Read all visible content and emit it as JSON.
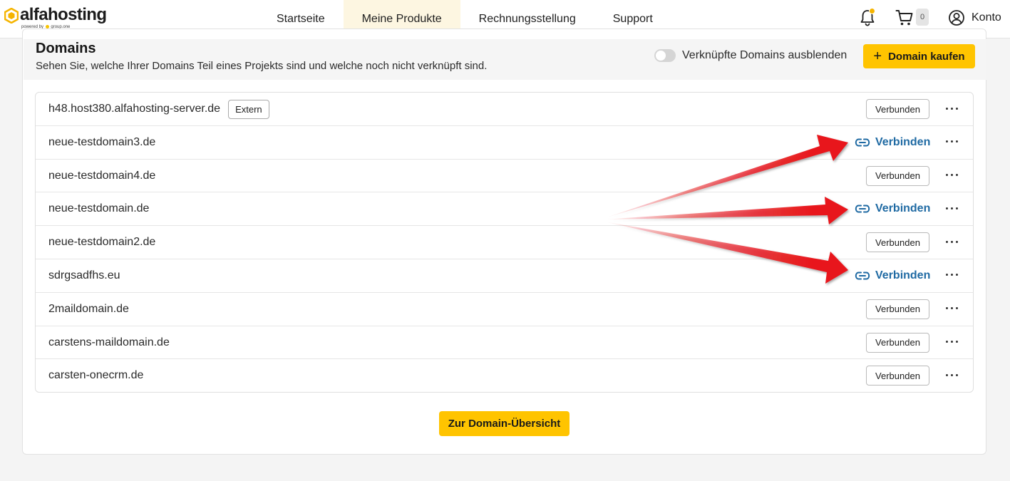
{
  "brand": {
    "name": "alfahosting",
    "tagline_prefix": "powered by",
    "tagline_suffix": "group.one"
  },
  "nav": {
    "items": [
      {
        "label": "Startseite",
        "active": false
      },
      {
        "label": "Meine Produkte",
        "active": true
      },
      {
        "label": "Rechnungsstellung",
        "active": false
      },
      {
        "label": "Support",
        "active": false
      }
    ]
  },
  "header_icons": {
    "notifications_icon": "bell-icon",
    "cart_icon": "cart-icon",
    "cart_count": "0",
    "account_label": "Konto"
  },
  "domains_section": {
    "title": "Domains",
    "subtitle": "Sehen Sie, welche Ihrer Domains Teil eines Projekts sind und welche noch nicht verknüpft sind.",
    "toggle_label": "Verknüpfte Domains ausblenden",
    "toggle_on": false,
    "buy_button": "Domain kaufen",
    "overview_button": "Zur Domain-Übersicht"
  },
  "domains": [
    {
      "name": "h48.host380.alfahosting-server.de",
      "badge": "Extern",
      "action": "Verbunden",
      "connected": true
    },
    {
      "name": "neue-testdomain3.de",
      "badge": "",
      "action": "Verbinden",
      "connected": false
    },
    {
      "name": "neue-testdomain4.de",
      "badge": "",
      "action": "Verbunden",
      "connected": true
    },
    {
      "name": "neue-testdomain.de",
      "badge": "",
      "action": "Verbinden",
      "connected": false
    },
    {
      "name": "neue-testdomain2.de",
      "badge": "",
      "action": "Verbunden",
      "connected": true
    },
    {
      "name": "sdrgsadfhs.eu",
      "badge": "",
      "action": "Verbinden",
      "connected": false
    },
    {
      "name": "2maildomain.de",
      "badge": "",
      "action": "Verbunden",
      "connected": true
    },
    {
      "name": "carstens-maildomain.de",
      "badge": "",
      "action": "Verbunden",
      "connected": true
    },
    {
      "name": "carsten-onecrm.de",
      "badge": "",
      "action": "Verbunden",
      "connected": true
    }
  ],
  "colors": {
    "accent": "#ffc400",
    "link": "#1f6aa3",
    "annotation_arrow": "#e8141a"
  }
}
